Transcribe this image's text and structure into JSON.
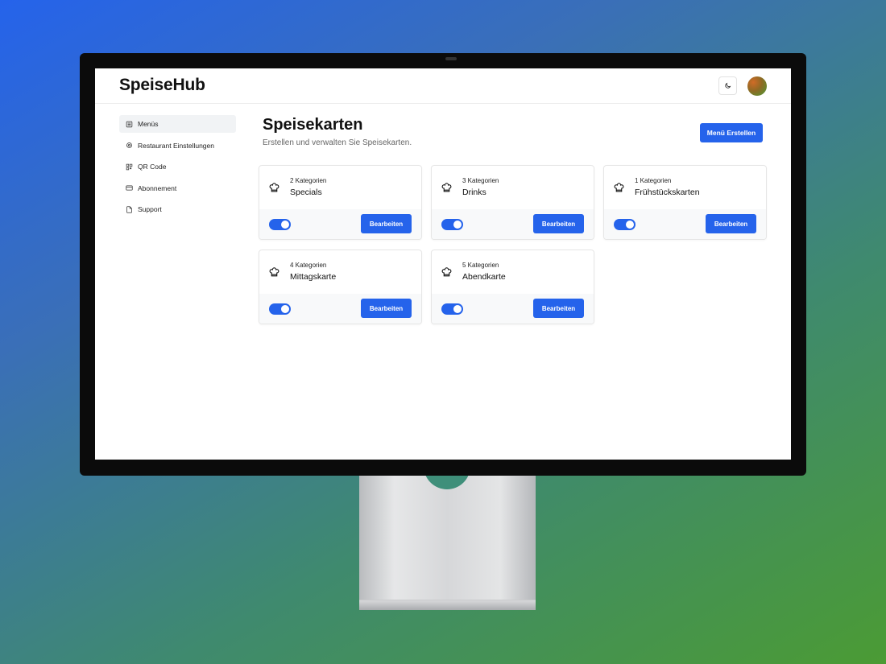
{
  "app": {
    "brand": "SpeiseHub"
  },
  "header": {
    "theme_icon": "moon-icon",
    "avatar_icon": "avatar"
  },
  "sidebar": {
    "items": [
      {
        "label": "Menüs",
        "icon": "list-icon",
        "active": true
      },
      {
        "label": "Restaurant Einstellungen",
        "icon": "gear-icon",
        "active": false
      },
      {
        "label": "QR Code",
        "icon": "qr-icon",
        "active": false
      },
      {
        "label": "Abonnement",
        "icon": "credit-card-icon",
        "active": false
      },
      {
        "label": "Support",
        "icon": "document-icon",
        "active": false
      }
    ]
  },
  "main": {
    "title": "Speisekarten",
    "subtitle": "Erstellen und verwalten Sie Speisekarten.",
    "create_label": "Menü Erstellen",
    "cards": [
      {
        "count": "2 Kategorien",
        "name": "Specials",
        "enabled": true,
        "edit_label": "Bearbeiten"
      },
      {
        "count": "3 Kategorien",
        "name": "Drinks",
        "enabled": true,
        "edit_label": "Bearbeiten"
      },
      {
        "count": "1 Kategorien",
        "name": "Frühstückskarten",
        "enabled": true,
        "edit_label": "Bearbeiten"
      },
      {
        "count": "4 Kategorien",
        "name": "Mittagskarte",
        "enabled": true,
        "edit_label": "Bearbeiten"
      },
      {
        "count": "5 Kategorien",
        "name": "Abendkarte",
        "enabled": true,
        "edit_label": "Bearbeiten"
      }
    ]
  },
  "colors": {
    "accent": "#2563eb",
    "background_start": "#2563eb",
    "background_end": "#4b9b34"
  }
}
